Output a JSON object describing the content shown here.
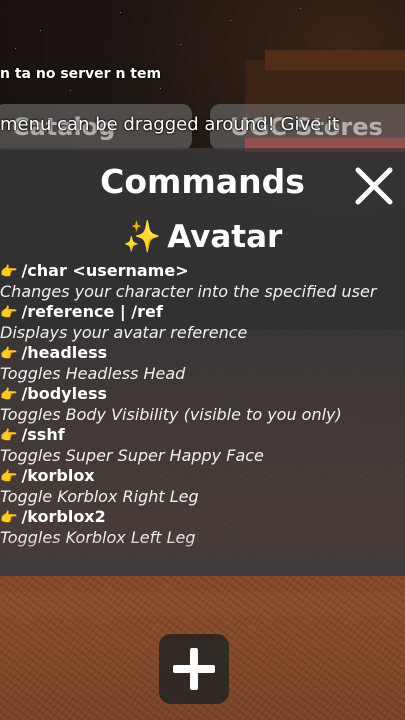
{
  "top_message": "n ta no server n tem",
  "drag_message": "menu can be dragged around! Give it",
  "tabs": [
    {
      "label": "Catalog"
    },
    {
      "label": "UGC Stores"
    }
  ],
  "panel": {
    "title": "Commands",
    "close_icon": "close-x-icon",
    "section": {
      "icon": "sparkles-icon",
      "sparkle": "✨",
      "title": "Avatar"
    },
    "hand_glyph": "👉",
    "commands": [
      {
        "name": "/char <username>",
        "desc": "Changes your character into the specified user"
      },
      {
        "name": "/reference | /ref",
        "desc": "Displays your avatar reference"
      },
      {
        "name": "/headless",
        "desc": "Toggles Headless Head"
      },
      {
        "name": "/bodyless",
        "desc": "Toggles Body Visibility (visible to you only)"
      },
      {
        "name": "/sshf",
        "desc": "Toggles Super Super Happy Face"
      },
      {
        "name": "/korblox",
        "desc": "Toggle Korblox Right Leg"
      },
      {
        "name": "/korblox2",
        "desc": "Toggles Korblox Left Leg"
      }
    ]
  },
  "bottom_button": {
    "icon": "plus-icon"
  },
  "colors": {
    "panel_bg": "#3a3a3c",
    "accent_sparkle": "#ffd23f",
    "hand": "#f3b63c",
    "text": "#ffffff"
  }
}
